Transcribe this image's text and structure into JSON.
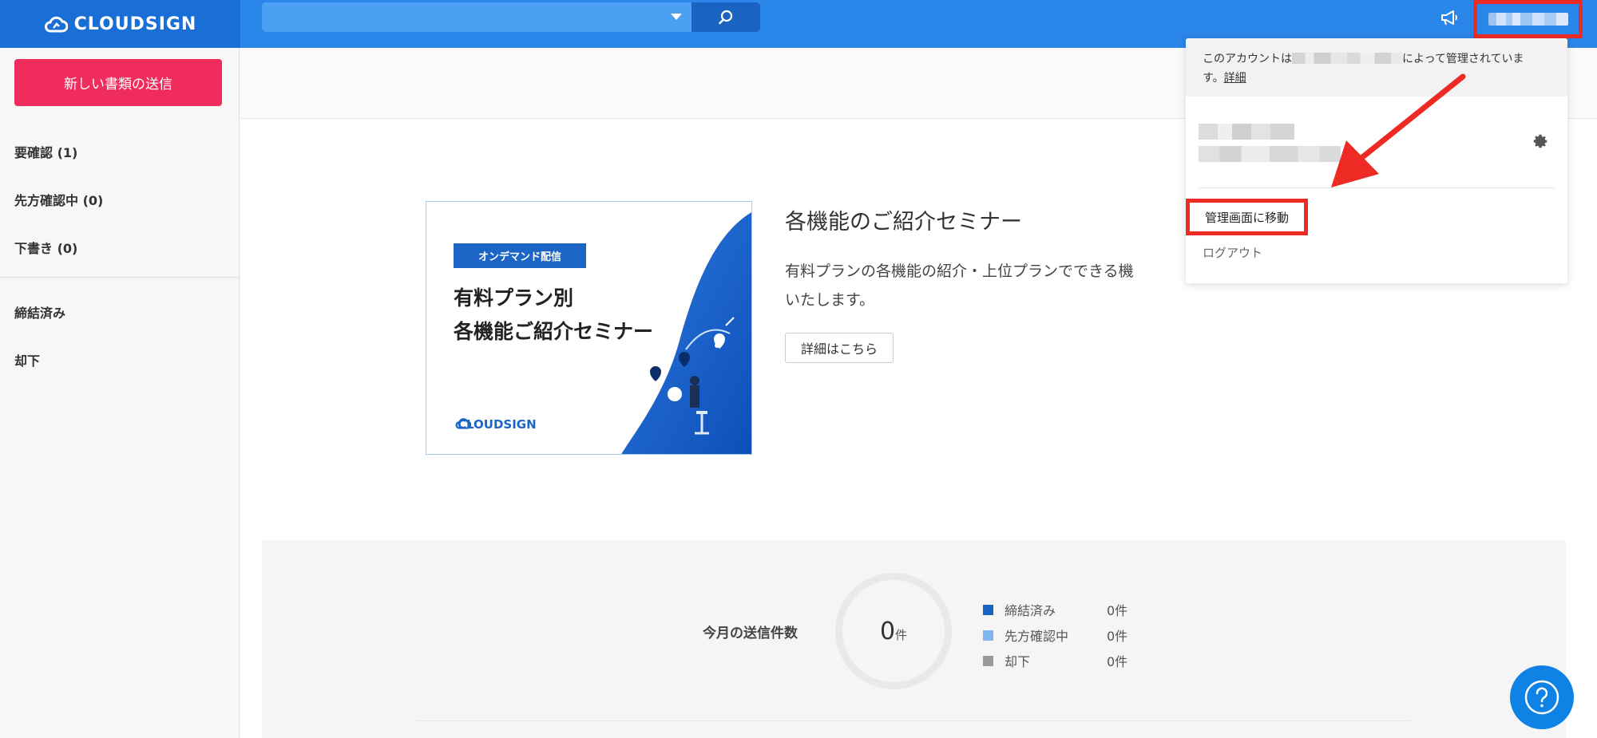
{
  "header": {
    "logo_text": "CLOUDSIGN",
    "search_placeholder": "",
    "icons": {
      "search": "search-icon",
      "caret": "chevron-down-icon",
      "megaphone": "megaphone-icon"
    }
  },
  "sidebar": {
    "new_document_label": "新しい書類の送信",
    "items": [
      {
        "label": "要確認 (1)"
      },
      {
        "label": "先方確認中 (0)"
      },
      {
        "label": "下書き (0)"
      },
      {
        "label": "締結済み"
      },
      {
        "label": "却下"
      }
    ]
  },
  "banner": {
    "tag": "オンデマンド配信",
    "title_line1": "有料プラン別",
    "title_line2": "各機能ご紹介セミナー",
    "logo_text": "CLOUDSIGN"
  },
  "seminar": {
    "title": "各機能のご紹介セミナー",
    "desc_line1": "有料プランの各機能の紹介・上位プランでできる機",
    "desc_line2": "いたします。",
    "detail_button": "詳細はこちら"
  },
  "stats": {
    "label": "今月の送信件数",
    "total": "0",
    "total_unit": "件",
    "legend": [
      {
        "name": "締結済み",
        "value": "0件",
        "color": "#1a63c2"
      },
      {
        "name": "先方確認中",
        "value": "0件",
        "color": "#7fb6f2"
      },
      {
        "name": "却下",
        "value": "0件",
        "color": "#9a9a9a"
      }
    ]
  },
  "dropdown": {
    "note_prefix": "このアカウントは",
    "note_suffix": "によって管理されていま",
    "note_line2": "す。",
    "note_link": "詳細",
    "admin_label": "管理画面に移動",
    "logout_label": "ログアウト"
  },
  "colors": {
    "header": "#2a86e8",
    "logo_bg": "#1a6fd6",
    "primary_button": "#ef2c5b",
    "highlight": "#ee2a24",
    "help_button": "#0f82e5"
  }
}
